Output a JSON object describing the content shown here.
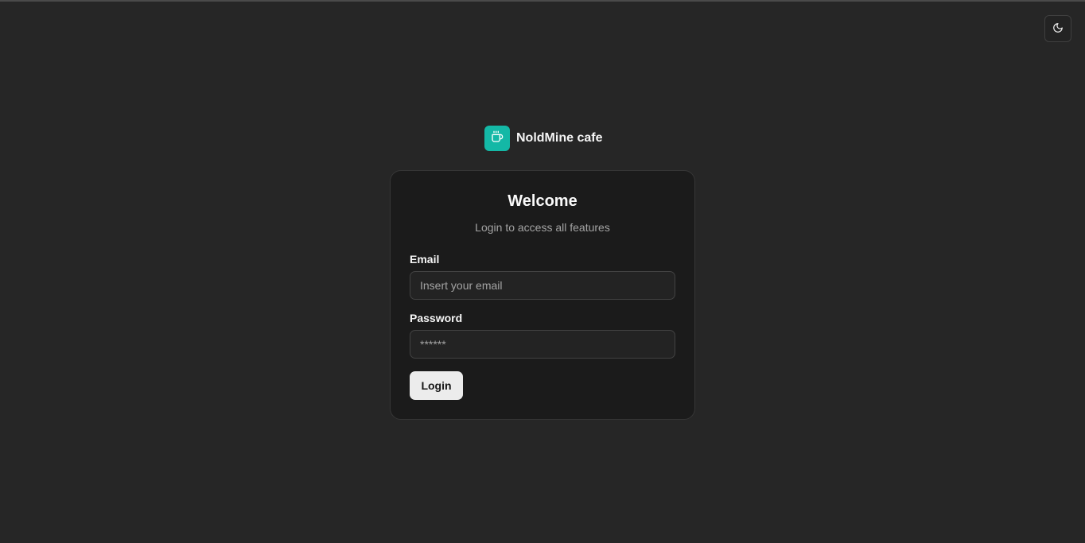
{
  "header": {
    "theme_toggle_icon": "moon-icon"
  },
  "brand": {
    "name": "NoldMine cafe",
    "logo_icon": "coffee-cup-icon",
    "accent_color": "#14b8a6"
  },
  "login_card": {
    "title": "Welcome",
    "subtitle": "Login to access all features",
    "email": {
      "label": "Email",
      "placeholder": "Insert your email",
      "value": ""
    },
    "password": {
      "label": "Password",
      "placeholder": "******",
      "value": ""
    },
    "submit_label": "Login"
  }
}
